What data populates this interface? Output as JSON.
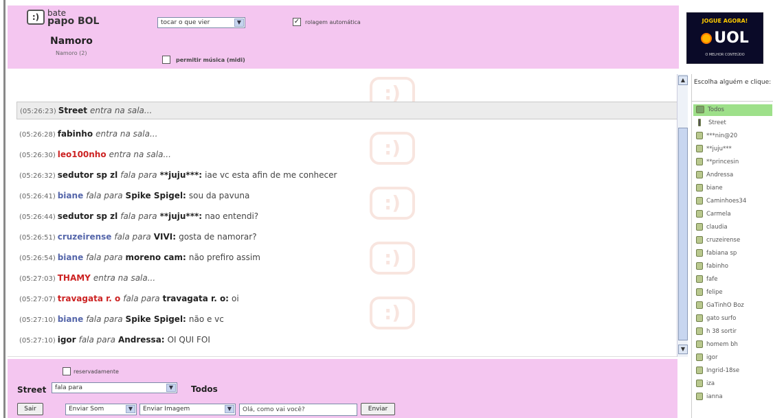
{
  "header": {
    "logo_icon": ":)",
    "logo_line1": "bate",
    "logo_line2": "papo BOL",
    "room_title": "Namoro",
    "room_subtitle": "Namoro (2)",
    "scroll_select": "tocar o que vier",
    "autoscroll_label": "rolagem automática",
    "autoscroll_checked": true,
    "music_label": "permitir música (midi)",
    "music_checked": false
  },
  "banner": {
    "top_text": "JOGUE AGORA!",
    "logo_text": "UOL",
    "bottom_text": "O MELHOR CONTEÚDO"
  },
  "messages": [
    {
      "time": "(05:26:23)",
      "user": "Street",
      "user_color": "#222222",
      "verb": "entra na sala...",
      "target": "",
      "text": ""
    },
    {
      "time": "(05:26:28)",
      "user": "fabinho",
      "user_color": "#222222",
      "verb": "entra na sala...",
      "target": "",
      "text": ""
    },
    {
      "time": "(05:26:30)",
      "user": "leo100nho",
      "user_color": "#cc2222",
      "verb": "entra na sala...",
      "target": "",
      "text": ""
    },
    {
      "time": "(05:26:32)",
      "user": "sedutor sp zl",
      "user_color": "#222222",
      "verb": "fala para",
      "target": "**juju***:",
      "text": "iae vc esta afin de me conhecer"
    },
    {
      "time": "(05:26:41)",
      "user": "biane",
      "user_color": "#5566aa",
      "verb": "fala para",
      "target": "Spike Spigel:",
      "text": "sou da pavuna"
    },
    {
      "time": "(05:26:44)",
      "user": "sedutor sp zl",
      "user_color": "#222222",
      "verb": "fala para",
      "target": "**juju***:",
      "text": "nao entendi?"
    },
    {
      "time": "(05:26:51)",
      "user": "cruzeirense",
      "user_color": "#5566aa",
      "verb": "fala para",
      "target": "VIVI:",
      "text": "gosta de namorar?"
    },
    {
      "time": "(05:26:54)",
      "user": "biane",
      "user_color": "#5566aa",
      "verb": "fala para",
      "target": "moreno cam:",
      "text": "não prefiro assim"
    },
    {
      "time": "(05:27:03)",
      "user": "THAMY",
      "user_color": "#cc2222",
      "verb": "entra na sala...",
      "target": "",
      "text": ""
    },
    {
      "time": "(05:27:07)",
      "user": "travagata r. o",
      "user_color": "#cc2222",
      "verb": "fala para",
      "target": "travagata r. o:",
      "text": "oi"
    },
    {
      "time": "(05:27:10)",
      "user": "biane",
      "user_color": "#5566aa",
      "verb": "fala para",
      "target": "Spike Spigel:",
      "text": "não e vc"
    },
    {
      "time": "(05:27:10)",
      "user": "igor",
      "user_color": "#222222",
      "verb": "fala para",
      "target": "Andressa:",
      "text": "OI QUI FOI"
    }
  ],
  "footer": {
    "reserved_label": "reservadamente",
    "reserved_checked": false,
    "sender": "Street",
    "verb_select": "fala para",
    "recipient": "Todos",
    "exit_button": "Sair",
    "sound_select": "Enviar Som",
    "image_select": "Enviar Imagem",
    "message_value": "Olá, como vai você?",
    "send_button": "Enviar"
  },
  "userlist": {
    "header": "Escolha alguém e clique:",
    "users": [
      {
        "name": "Todos",
        "kind": "group",
        "selected": true
      },
      {
        "name": "Street",
        "kind": "person",
        "selected": false
      },
      {
        "name": "***nin@20",
        "kind": "user",
        "selected": false
      },
      {
        "name": "**juju***",
        "kind": "user",
        "selected": false
      },
      {
        "name": "**princesin",
        "kind": "user",
        "selected": false
      },
      {
        "name": "Andressa",
        "kind": "user",
        "selected": false
      },
      {
        "name": "biane",
        "kind": "user",
        "selected": false
      },
      {
        "name": "Caminhoes34",
        "kind": "user",
        "selected": false
      },
      {
        "name": "Carmela",
        "kind": "user",
        "selected": false
      },
      {
        "name": "claudia",
        "kind": "user",
        "selected": false
      },
      {
        "name": "cruzeirense",
        "kind": "user",
        "selected": false
      },
      {
        "name": "fabiana sp",
        "kind": "user",
        "selected": false
      },
      {
        "name": "fabinho",
        "kind": "user",
        "selected": false
      },
      {
        "name": "fafe",
        "kind": "user",
        "selected": false
      },
      {
        "name": "felipe",
        "kind": "user",
        "selected": false
      },
      {
        "name": "GaTinhO Boz",
        "kind": "user",
        "selected": false
      },
      {
        "name": "gato surfo",
        "kind": "user",
        "selected": false
      },
      {
        "name": "h 38 sortir",
        "kind": "user",
        "selected": false
      },
      {
        "name": "homem bh",
        "kind": "user",
        "selected": false
      },
      {
        "name": "igor",
        "kind": "user",
        "selected": false
      },
      {
        "name": "Ingrid-18se",
        "kind": "user",
        "selected": false
      },
      {
        "name": "iza",
        "kind": "user",
        "selected": false
      },
      {
        "name": "ianna",
        "kind": "user",
        "selected": false
      }
    ]
  }
}
